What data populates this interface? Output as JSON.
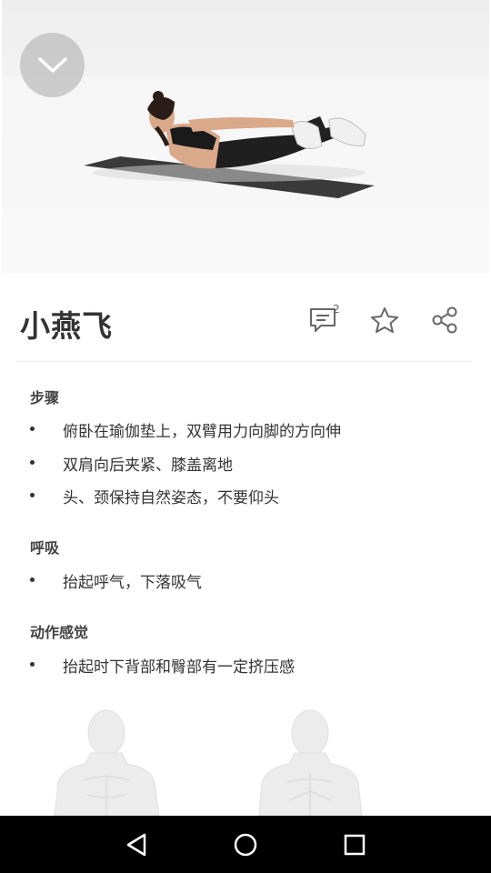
{
  "exercise": {
    "title": "小燕飞",
    "comment_count": "2"
  },
  "icons": {
    "collapse": "chevron-down-icon",
    "comment": "comment-icon",
    "favorite": "star-icon",
    "share": "share-icon"
  },
  "sections": {
    "steps": {
      "title": "步骤",
      "items": [
        "俯卧在瑜伽垫上，双臂用力向脚的方向伸",
        "双肩向后夹紧、膝盖离地",
        "头、颈保持自然姿态，不要仰头"
      ]
    },
    "breathing": {
      "title": "呼吸",
      "items": [
        "抬起呼气，下落吸气"
      ]
    },
    "feeling": {
      "title": "动作感觉",
      "items": [
        "抬起时下背部和臀部有一定挤压感"
      ]
    }
  },
  "colors": {
    "nav_bar": "#000000",
    "text": "#333333",
    "hero_bg": "#f5f5f5"
  }
}
